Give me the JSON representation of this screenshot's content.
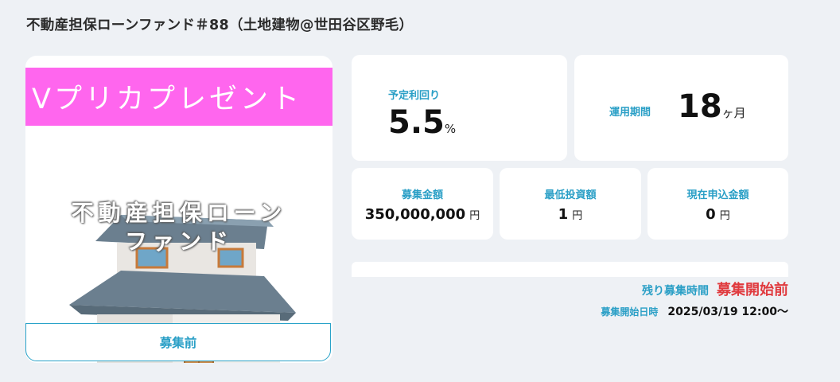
{
  "page": {
    "title": "不動産担保ローンファンド＃88（土地建物@世田谷区野毛）"
  },
  "image_card": {
    "banner_text": "Vプリカプレゼント",
    "overlay_line1": "不動産担保ローン",
    "overlay_line2": "ファンド",
    "status_label": "募集前"
  },
  "metrics": {
    "rate": {
      "label": "予定利回り",
      "value": "5.5",
      "unit": "%"
    },
    "term": {
      "label": "運用期間",
      "value": "18",
      "unit": "ヶ月"
    },
    "amount": {
      "label": "募集金額",
      "value": "350,000,000",
      "unit": "円"
    },
    "min_invest": {
      "label": "最低投資額",
      "value": "1",
      "unit": "円"
    },
    "current": {
      "label": "現在申込金額",
      "value": "0",
      "unit": "円"
    }
  },
  "schedule": {
    "remaining_label": "残り募集時間",
    "remaining_value": "募集開始前",
    "start_label": "募集開始日時",
    "start_value": "2025/03/19 12:00〜"
  },
  "colors": {
    "accent": "#2a9fc6",
    "alert": "#e03a3e",
    "banner": "#ff66ee",
    "background": "#eef1f5"
  }
}
